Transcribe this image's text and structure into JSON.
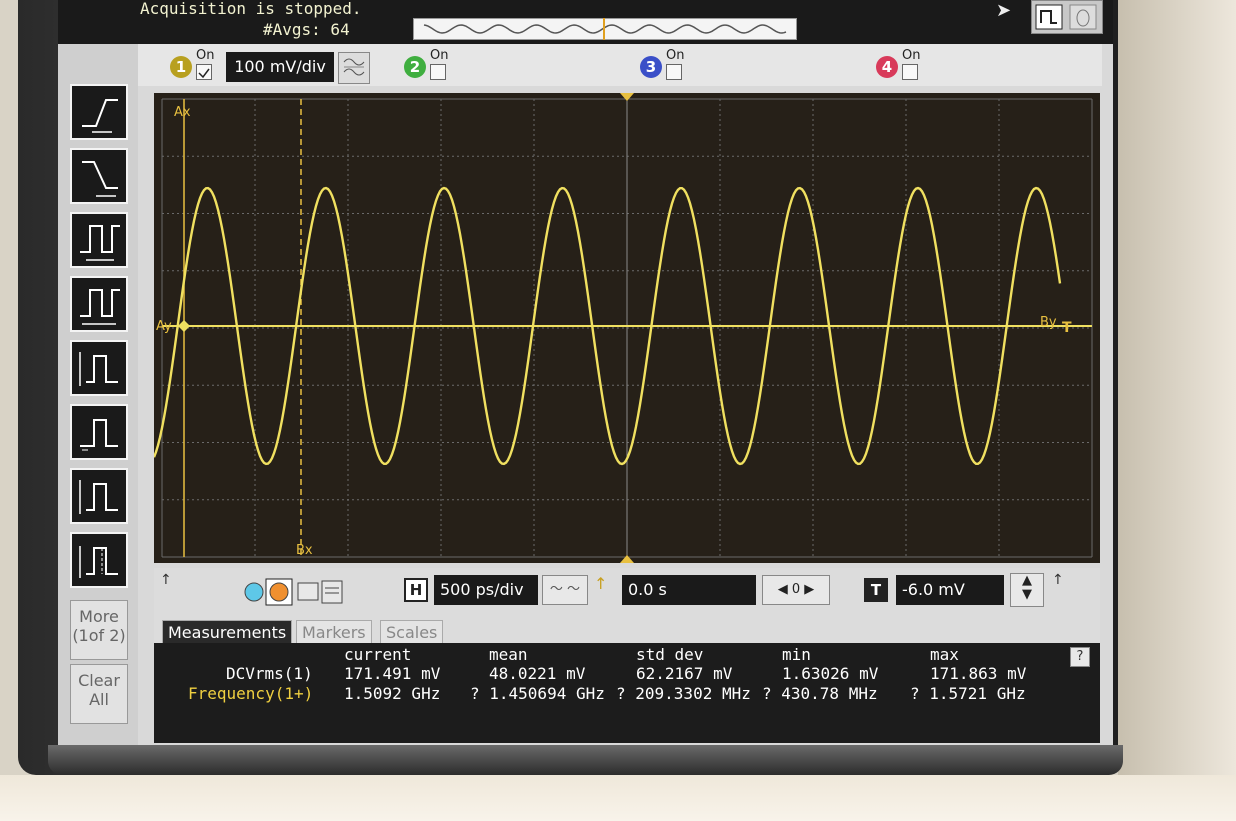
{
  "status": {
    "acquisition": "Acquisition is stopped.",
    "averages": "#Avgs: 64"
  },
  "channels": [
    {
      "number": "1",
      "on_label": "On",
      "enabled": true,
      "scale": "100 mV/div",
      "color": "#e8d84a"
    },
    {
      "number": "2",
      "on_label": "On",
      "enabled": false,
      "color": "#3fae3f"
    },
    {
      "number": "3",
      "on_label": "On",
      "enabled": false,
      "color": "#3a4fc8"
    },
    {
      "number": "4",
      "on_label": "On",
      "enabled": false,
      "color": "#d83a5a"
    }
  ],
  "toolbar": {
    "more_label": "More\n(1of 2)",
    "clear_label": "Clear\nAll",
    "buttons": [
      "rising-edge-icon",
      "falling-edge-icon",
      "pulse-width-icon",
      "pulse-width-ratio-icon",
      "rise-time-icon",
      "overshoot-icon",
      "period-icon",
      "jitter-icon"
    ]
  },
  "graticule": {
    "marker_a": "Ax",
    "marker_a_left": "Ay",
    "marker_b": "Bx",
    "marker_b_right": "By",
    "trigger_marker": "T",
    "waveform_color": "#f0e060",
    "grid_color": "#6a6a6a"
  },
  "controls": {
    "horizontal_button": "H",
    "timebase": "500 ps/div",
    "delay": "0.0 s",
    "reference": "0",
    "trigger_button": "T",
    "trigger_level": "-6.0 mV"
  },
  "tabs": [
    "Measurements",
    "Markers",
    "Scales"
  ],
  "measurements": {
    "headers": [
      "current",
      "mean",
      "std dev",
      "min",
      "max"
    ],
    "rows": [
      {
        "name": "DCVrms(1)",
        "values": [
          "171.491 mV",
          "48.0221 mV",
          "62.2167 mV",
          "1.63026 mV",
          "171.863 mV"
        ],
        "color": "#ffffff"
      },
      {
        "name": "Frequency(1+)",
        "values": [
          "1.5092 GHz",
          "? 1.450694 GHz",
          "? 209.3302 MHz",
          "? 430.78 MHz",
          "? 1.5721 GHz"
        ],
        "color": "#f0d040"
      }
    ]
  }
}
